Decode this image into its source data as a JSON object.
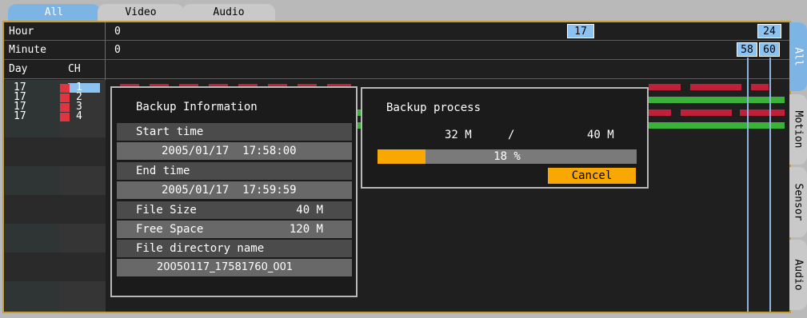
{
  "tabs": {
    "top": [
      "All",
      "Video",
      "Audio"
    ],
    "side": [
      "All",
      "Motion",
      "Sensor",
      "Audio"
    ]
  },
  "timeline": {
    "hour_label": "Hour",
    "minute_label": "Minute",
    "day_header": "Day",
    "ch_header": "CH",
    "hour_start": "0",
    "hour_badge": "17",
    "hour_end": "24",
    "minute_start": "0",
    "minute_badge_a": "58",
    "minute_badge_b": "60",
    "rows": [
      {
        "day": "17",
        "ch": "1"
      },
      {
        "day": "17",
        "ch": "2"
      },
      {
        "day": "17",
        "ch": "3"
      },
      {
        "day": "17",
        "ch": "4"
      }
    ]
  },
  "backup_info": {
    "title": "Backup Information",
    "start_label": "Start time",
    "start_value": "2005/01/17  17:58:00",
    "end_label": "End time",
    "end_value": "2005/01/17  17:59:59",
    "file_size_label": "File Size",
    "file_size_value": "40 M",
    "free_space_label": "Free Space",
    "free_space_value": "120 M",
    "dir_label": "File directory name",
    "dir_value": "20050117_17581760_001"
  },
  "backup_process": {
    "title": "Backup process",
    "done": "32 M",
    "separator": "/",
    "total": "40 M",
    "progress_text": "18 %",
    "progress": 0.18,
    "cancel_label": "Cancel"
  },
  "colors": {
    "accent": "#8cc2f0",
    "frame": "#c79e2e",
    "record": "#c0203a",
    "motion": "#3ab23a",
    "cancel": "#f8a800"
  }
}
